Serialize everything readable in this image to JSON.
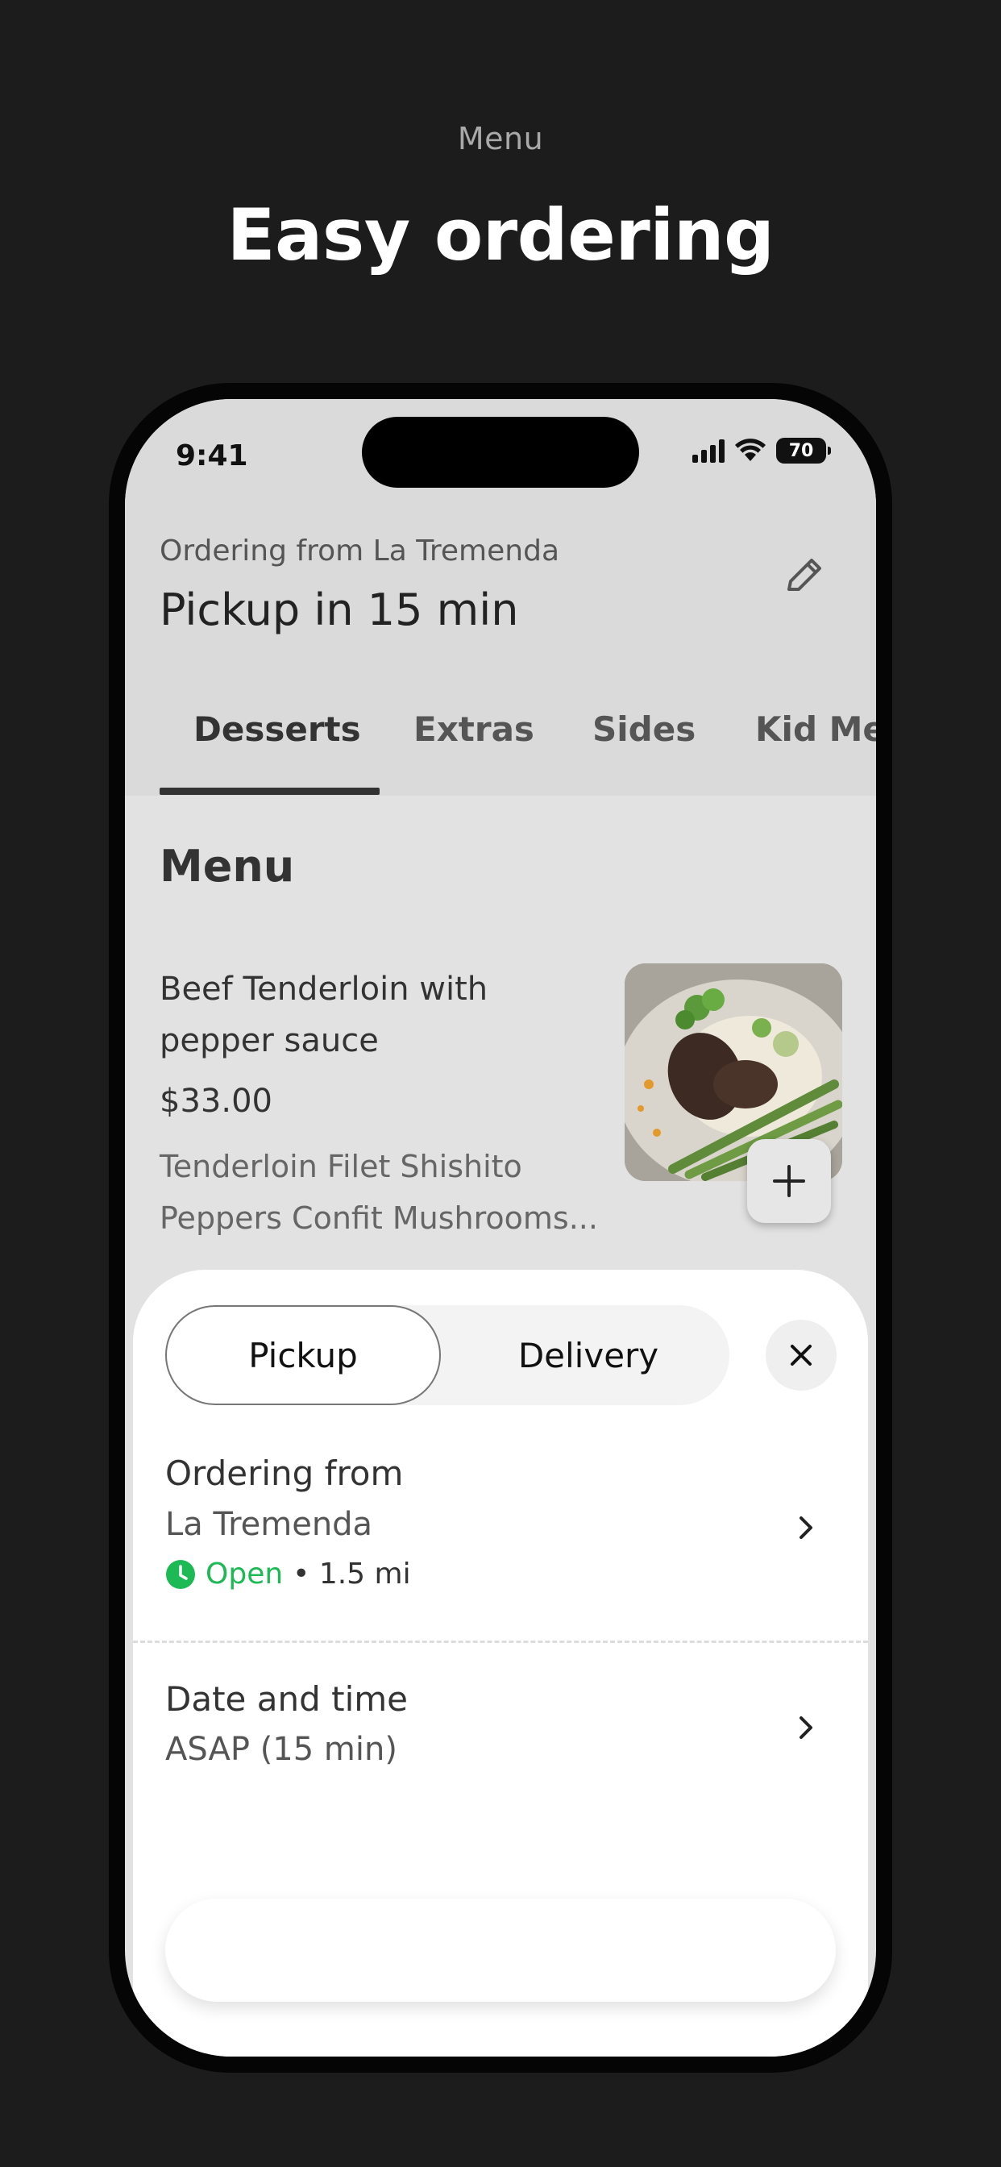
{
  "promo": {
    "subtitle": "Menu",
    "title": "Easy ordering"
  },
  "status_bar": {
    "time": "9:41",
    "battery": "70"
  },
  "header": {
    "ordering_from": "Ordering from La Tremenda",
    "pickup_title": "Pickup in 15 min"
  },
  "tabs": [
    {
      "label": "Desserts",
      "active": true
    },
    {
      "label": "Extras",
      "active": false
    },
    {
      "label": "Sides",
      "active": false
    },
    {
      "label": "Kid Menu",
      "active": false
    }
  ],
  "menu": {
    "section_title": "Menu",
    "item": {
      "name": "Beef Tenderloin with pepper sauce",
      "price": "$33.00",
      "description_line1": "Tenderloin Filet Shishito",
      "description_line2": "Peppers Confit Mushrooms..."
    }
  },
  "sheet": {
    "mode_pickup": "Pickup",
    "mode_delivery": "Delivery",
    "selected_mode": "Pickup",
    "ordering_from_label": "Ordering from",
    "restaurant_name": "La Tremenda",
    "open_status": "Open",
    "distance": "• 1.5 mi",
    "date_time_label": "Date and time",
    "date_time_value": "ASAP (15 min)"
  },
  "colors": {
    "background": "#1c1c1c",
    "open_green": "#1db954",
    "screen_dim": "#e2e2e2"
  },
  "icons": {
    "edit": "pencil-icon",
    "add": "plus-icon",
    "close": "close-icon",
    "chevron": "chevron-right-icon",
    "clock": "clock-icon"
  }
}
